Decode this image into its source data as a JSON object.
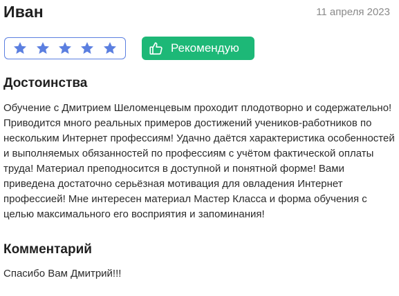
{
  "review": {
    "author": "Иван",
    "date": "11 апреля 2023",
    "rating": {
      "value": 5,
      "max": 5,
      "icon": "star-icon"
    },
    "recommend_label": "Рекомендую",
    "recommend_icon": "thumbs-up-icon",
    "pros_title": "Достоинства",
    "pros_text": "Обучение с Дмитрием Шеломенцевым проходит плодотворно и содержательно! Приводится много реальных примеров достижений учеников-работников по нескольким Интернет профессиям! Удачно даётся характеристика особенностей и выполняемых обязанностей по профессиям с учётом фактической оплаты труда! Материал преподносится в доступной и понятной форме! Вами приведена достаточно серьёзная мотивация для овладения Интернет профессией! Мне интересен материал Мастер Класса и форма обучения с целью максимального его восприятия и запоминания!",
    "comment_title": "Комментарий",
    "comment_text": "Спасибо Вам Дмитрий!!!"
  },
  "colors": {
    "star": "#5b7fe0",
    "rating_border": "#5b7fe0",
    "recommend_bg": "#1db877",
    "date_text": "#8a8a8a"
  }
}
